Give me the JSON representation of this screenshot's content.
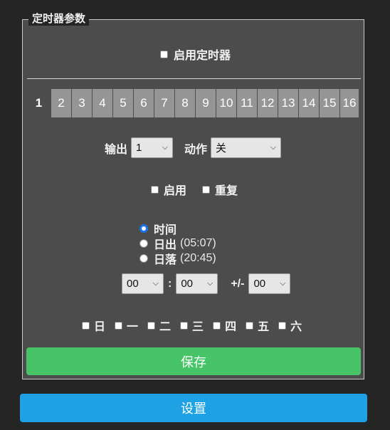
{
  "legend": "定时器参数",
  "enable_timer_label": "启用定时器",
  "tabs": [
    "1",
    "2",
    "3",
    "4",
    "5",
    "6",
    "7",
    "8",
    "9",
    "10",
    "11",
    "12",
    "13",
    "14",
    "15",
    "16"
  ],
  "active_tab": "1",
  "output_label": "输出",
  "output_value": "1",
  "action_label": "动作",
  "action_value": "关",
  "enable_label": "启用",
  "repeat_label": "重复",
  "mode_options": [
    {
      "label": "时间",
      "extra": "",
      "selected": true
    },
    {
      "label": "日出",
      "extra": "(05:07)",
      "selected": false
    },
    {
      "label": "日落",
      "extra": "(20:45)",
      "selected": false
    }
  ],
  "hour_value": "00",
  "minute_value": "00",
  "time_colon": ":",
  "offset_label": "+/-",
  "offset_value": "00",
  "days": [
    "日",
    "一",
    "二",
    "三",
    "四",
    "五",
    "六"
  ],
  "save_label": "保存",
  "settings_label": "设置",
  "colors": {
    "save": "#46c467",
    "settings": "#1ea2e5",
    "panel": "#4c4c4c",
    "radio_accent": "#1a73e8"
  }
}
